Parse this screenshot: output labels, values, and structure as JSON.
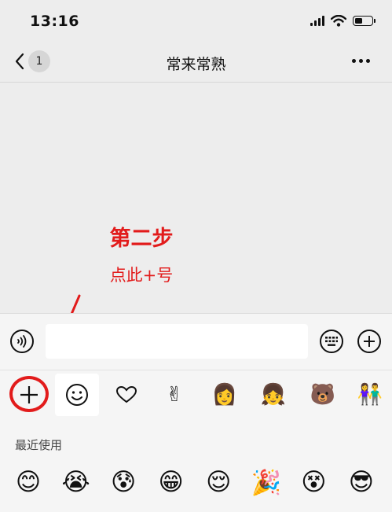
{
  "status_bar": {
    "time": "13:16",
    "battery_level": 0.45
  },
  "nav": {
    "back_count": "1",
    "title": "常来常熟"
  },
  "annotation": {
    "step": "第二步",
    "hint": "点此+号",
    "color": "#e21b1b"
  },
  "input_bar": {
    "placeholder": ""
  },
  "emoji_tabs": {
    "smiley": "😊",
    "heart": "♡",
    "victory": "✌",
    "sticker1": "👩",
    "sticker2": "👧",
    "sticker3": "🐻",
    "sticker4": "👫"
  },
  "recent": {
    "title": "最近使用",
    "items": [
      "😊",
      "😭",
      "😰",
      "😁",
      "😌",
      "🎉",
      "😵",
      "😎"
    ]
  }
}
